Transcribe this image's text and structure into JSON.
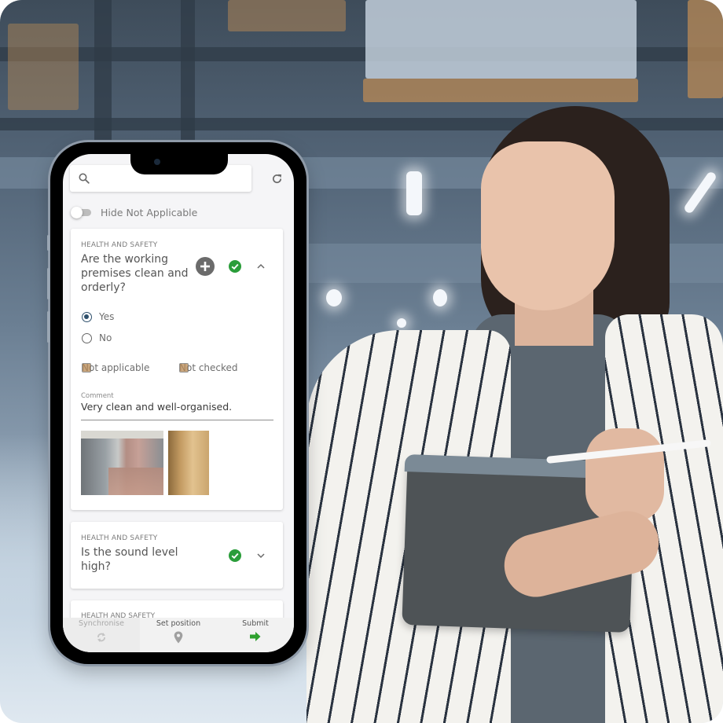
{
  "toolbar": {
    "search_icon": "search-icon",
    "search_placeholder": "",
    "refresh_icon": "refresh-icon"
  },
  "filter": {
    "toggle_label": "Hide Not Applicable",
    "toggle_on": false
  },
  "questions": [
    {
      "category": "Health and Safety",
      "text": "Are the working premises clean and orderly?",
      "expanded": true,
      "status": "completed",
      "options": [
        {
          "label": "Yes",
          "selected": true
        },
        {
          "label": "No",
          "selected": false
        }
      ],
      "flags": [
        {
          "label": "Not applicable",
          "checked": false
        },
        {
          "label": "Not checked",
          "checked": false
        }
      ],
      "comment_label": "Comment",
      "comment_value": "Very clean and well-organised.",
      "photos": [
        "winery-tanks-photo",
        "barrel-cellar-photo"
      ]
    },
    {
      "category": "Health and Safety",
      "text": "Is the sound level high?",
      "expanded": false,
      "status": "completed"
    },
    {
      "category": "Health and Safety"
    }
  ],
  "bottom_nav": {
    "items": [
      {
        "label": "Synchronise",
        "icon": "sync-icon",
        "enabled": false
      },
      {
        "label": "Set position",
        "icon": "location-pin-icon",
        "enabled": true
      },
      {
        "label": "Submit",
        "icon": "arrow-right-icon",
        "enabled": true
      }
    ]
  },
  "colors": {
    "success": "#2a9d3a",
    "submit_arrow": "#2ea02e",
    "radio_selected": "#2e4f6b",
    "add_button": "#6b6b6b"
  }
}
